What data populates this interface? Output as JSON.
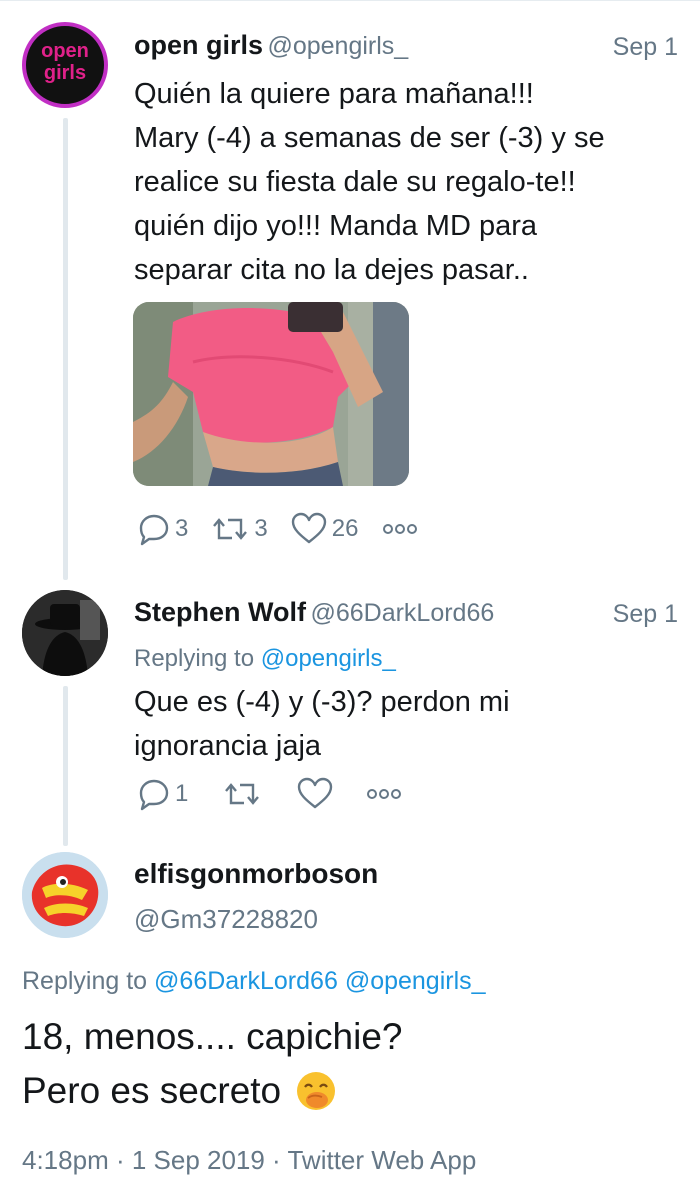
{
  "tweets": [
    {
      "name": "open girls",
      "handle": "@opengirls_",
      "date": "Sep 1",
      "avatar_text_1": "open",
      "avatar_text_2": "girls",
      "lines": [
        "Quién la quiere para mañana!!!",
        "Mary (-4) a semanas de ser (-3) y se",
        "realice su fiesta dale su regalo-te!!",
        "quién dijo yo!!! Manda MD para",
        "separar cita no la dejes pasar.."
      ],
      "replies": "3",
      "retweets": "3",
      "likes": "26"
    },
    {
      "name": "Stephen Wolf",
      "handle": "@66DarkLord66",
      "date": "Sep 1",
      "replying_prefix": "Replying to",
      "replying_to": "@opengirls_",
      "lines": [
        "Que es (-4) y (-3)?  perdon mi",
        "ignorancia jaja"
      ],
      "replies": "1"
    }
  ],
  "main_tweet": {
    "name": "elfisgonmorboson",
    "handle": "@Gm37228820",
    "replying_prefix": "Replying to",
    "replying_to_1": "@66DarkLord66",
    "replying_to_2": "@opengirls_",
    "line1": "18, menos.... capichie?",
    "line2": "Pero es secreto",
    "emoji": "🤭",
    "meta": "4:18pm · 1 Sep 2019 · Twitter Web App"
  },
  "colors": {
    "link": "#1b95e0",
    "muted": "#657786",
    "thread_line": "#e1e8ed",
    "brand_pink": "#e0218a"
  },
  "icons": [
    "reply-icon",
    "retweet-icon",
    "like-icon",
    "more-icon"
  ]
}
